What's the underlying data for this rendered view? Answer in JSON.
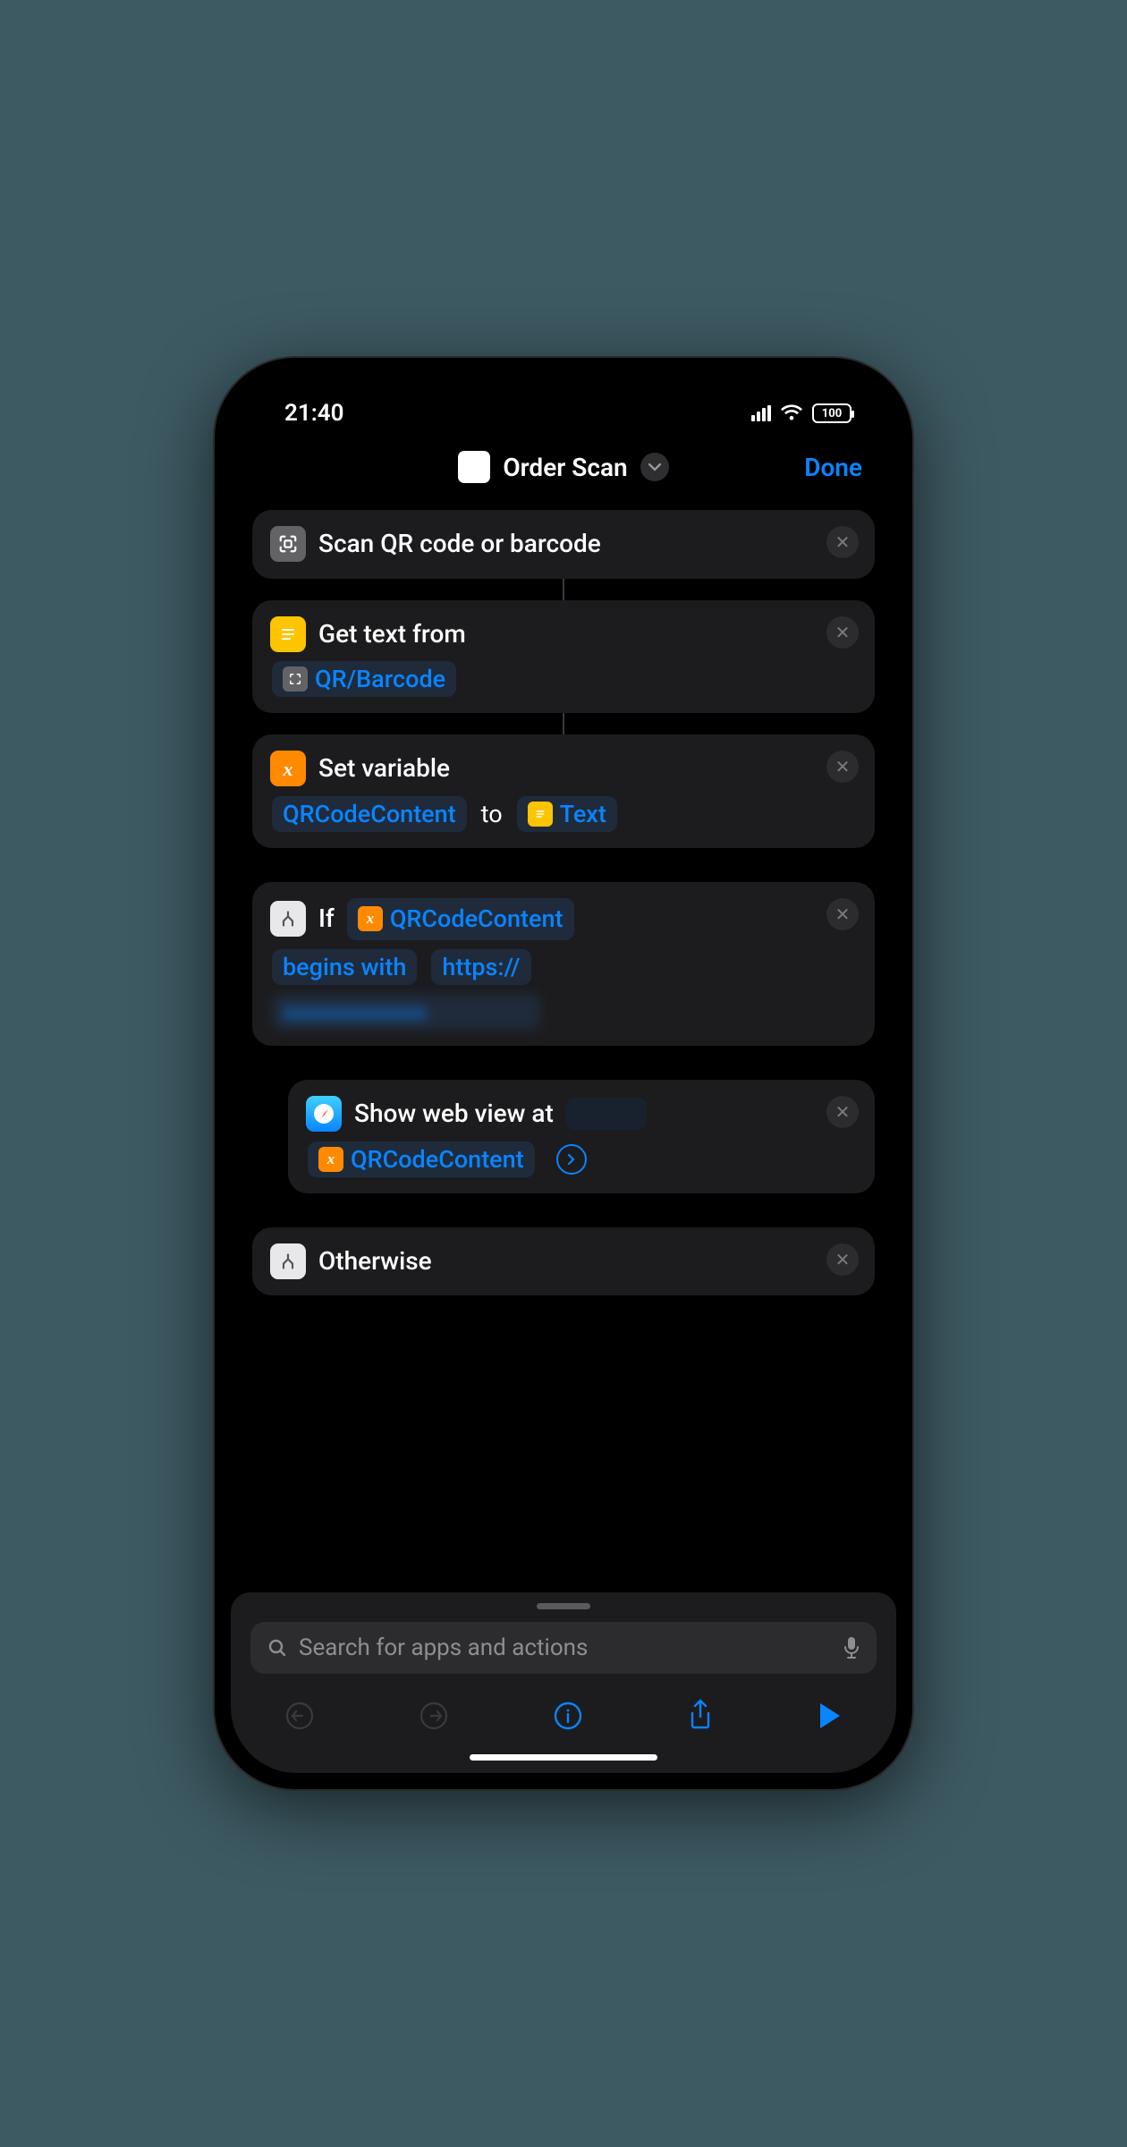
{
  "status": {
    "time": "21:40",
    "battery": "100"
  },
  "header": {
    "title": "Order Scan",
    "done": "Done"
  },
  "actions": {
    "scan": {
      "label": "Scan QR code or barcode"
    },
    "getText": {
      "label": "Get text from",
      "source": "QR/Barcode"
    },
    "setVar": {
      "label": "Set variable",
      "varName": "QRCodeContent",
      "to": "to",
      "value": "Text"
    },
    "if": {
      "label": "If",
      "var": "QRCodeContent",
      "condition": "begins with",
      "value": "https://"
    },
    "webview": {
      "label": "Show web view at",
      "var": "QRCodeContent"
    },
    "otherwise": {
      "label": "Otherwise"
    }
  },
  "search": {
    "placeholder": "Search for apps and actions"
  }
}
